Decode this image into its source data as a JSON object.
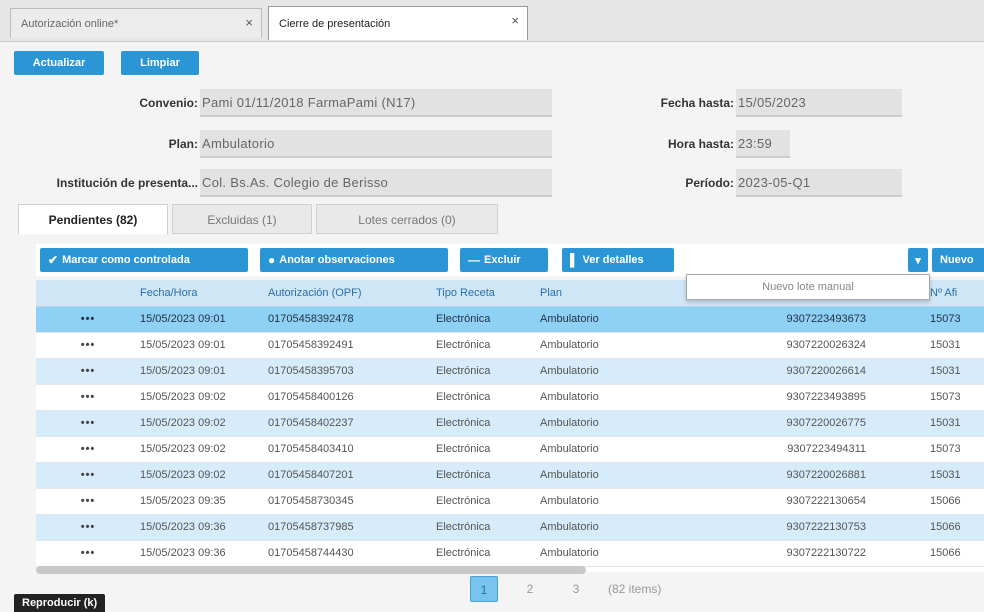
{
  "tabs": [
    {
      "label": "Autorización online*",
      "close": "×"
    },
    {
      "label": "Cierre de presentación",
      "close": "×"
    }
  ],
  "actions": {
    "refresh": "Actualizar",
    "clear": "Limpiar"
  },
  "form": {
    "convenio_label": "Convenio:",
    "convenio_value": "Pami 01/11/2018   FarmaPami (N17)",
    "plan_label": "Plan:",
    "plan_value": "Ambulatorio",
    "institucion_label": "Institución de presenta...",
    "institucion_value": "Col. Bs.As. Colegio de Berisso",
    "fecha_hasta_label": "Fecha hasta:",
    "fecha_hasta_value": "15/05/2023",
    "hora_hasta_label": "Hora hasta:",
    "hora_hasta_value": "23:59",
    "periodo_label": "Período:",
    "periodo_value": "2023-05-Q1"
  },
  "subtabs": [
    "Pendientes (82)",
    "Excluidas (1)",
    "Lotes cerrados (0)"
  ],
  "toolbar": {
    "mark": "Marcar como controlada",
    "notes": "Anotar observaciones",
    "exclude": "Excluir",
    "details": "Ver detalles",
    "new": "Nuevo"
  },
  "dropdown": {
    "item": "Nuevo lote manual"
  },
  "grid": {
    "columns": [
      "",
      "Fecha/Hora",
      "Autorización (OPF)",
      "Tipo Receta",
      "Plan",
      "",
      "Nº Afi"
    ],
    "rows": [
      [
        "•••",
        "15/05/2023 09:01",
        "01705458392478",
        "Electrónica",
        "Ambulatorio",
        "9307223493673",
        "15073"
      ],
      [
        "•••",
        "15/05/2023 09:01",
        "01705458392491",
        "Electrónica",
        "Ambulatorio",
        "9307220026324",
        "15031"
      ],
      [
        "•••",
        "15/05/2023 09:01",
        "01705458395703",
        "Electrónica",
        "Ambulatorio",
        "9307220026614",
        "15031"
      ],
      [
        "•••",
        "15/05/2023 09:02",
        "01705458400126",
        "Electrónica",
        "Ambulatorio",
        "9307223493895",
        "15073"
      ],
      [
        "•••",
        "15/05/2023 09:02",
        "01705458402237",
        "Electrónica",
        "Ambulatorio",
        "9307220026775",
        "15031"
      ],
      [
        "•••",
        "15/05/2023 09:02",
        "01705458403410",
        "Electrónica",
        "Ambulatorio",
        "9307223494311",
        "15073"
      ],
      [
        "•••",
        "15/05/2023 09:02",
        "01705458407201",
        "Electrónica",
        "Ambulatorio",
        "9307220026881",
        "15031"
      ],
      [
        "•••",
        "15/05/2023 09:35",
        "01705458730345",
        "Electrónica",
        "Ambulatorio",
        "9307222130654",
        "15066"
      ],
      [
        "•••",
        "15/05/2023 09:36",
        "01705458737985",
        "Electrónica",
        "Ambulatorio",
        "9307222130753",
        "15066"
      ],
      [
        "•••",
        "15/05/2023 09:36",
        "01705458744430",
        "Electrónica",
        "Ambulatorio",
        "9307222130722",
        "15066"
      ]
    ]
  },
  "pager": {
    "pages": [
      "1",
      "2",
      "3"
    ],
    "count": "(82 items)"
  },
  "overlay": {
    "label": "Reproducir (k)"
  }
}
